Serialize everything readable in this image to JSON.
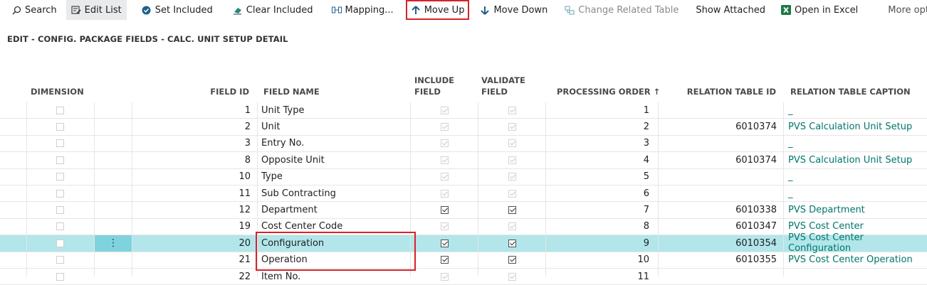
{
  "toolbar": {
    "search": "Search",
    "edit_list": "Edit List",
    "set_included": "Set Included",
    "clear_included": "Clear Included",
    "mapping": "Mapping...",
    "move_up": "Move Up",
    "move_down": "Move Down",
    "change_related_table": "Change Related Table",
    "show_attached": "Show Attached",
    "open_in_excel": "Open in Excel",
    "more_options": "More options"
  },
  "page": {
    "caption": "EDIT - CONFIG. PACKAGE FIELDS - CALC. UNIT SETUP DETAIL"
  },
  "columns": {
    "dimension": "DIMENSION",
    "field_id": "FIELD ID",
    "field_name": "FIELD NAME",
    "include_field_1": "INCLUDE",
    "include_field_2": "FIELD",
    "validate_field_1": "VALIDATE",
    "validate_field_2": "FIELD",
    "processing_order": "PROCESSING ORDER ↑",
    "relation_table_id": "RELATION TABLE ID",
    "relation_table_caption": "RELATION TABLE CAPTION"
  },
  "rows": [
    {
      "field_id": "1",
      "field_name": "Unit Type",
      "include": "ro",
      "validate": "ro",
      "order": "1",
      "rel_id": "",
      "rel_caption": "_"
    },
    {
      "field_id": "2",
      "field_name": "Unit",
      "include": "ro",
      "validate": "ro",
      "order": "2",
      "rel_id": "6010374",
      "rel_caption": "PVS Calculation Unit Setup"
    },
    {
      "field_id": "3",
      "field_name": "Entry No.",
      "include": "ro",
      "validate": "ro",
      "order": "3",
      "rel_id": "",
      "rel_caption": "_"
    },
    {
      "field_id": "8",
      "field_name": "Opposite Unit",
      "include": "ro",
      "validate": "ro",
      "order": "4",
      "rel_id": "6010374",
      "rel_caption": "PVS Calculation Unit Setup"
    },
    {
      "field_id": "10",
      "field_name": "Type",
      "include": "ro",
      "validate": "ro",
      "order": "5",
      "rel_id": "",
      "rel_caption": "_"
    },
    {
      "field_id": "11",
      "field_name": "Sub Contracting",
      "include": "ro",
      "validate": "ro",
      "order": "6",
      "rel_id": "",
      "rel_caption": "_"
    },
    {
      "field_id": "12",
      "field_name": "Department",
      "include": "checked",
      "validate": "checked",
      "order": "7",
      "rel_id": "6010338",
      "rel_caption": "PVS Department"
    },
    {
      "field_id": "19",
      "field_name": "Cost Center Code",
      "include": "ro",
      "validate": "ro",
      "order": "8",
      "rel_id": "6010347",
      "rel_caption": "PVS Cost Center"
    },
    {
      "field_id": "20",
      "field_name": "Configuration",
      "include": "checked",
      "validate": "checked",
      "order": "9",
      "rel_id": "6010354",
      "rel_caption": "PVS Cost Center Configuration"
    },
    {
      "field_id": "21",
      "field_name": "Operation",
      "include": "checked",
      "validate": "checked",
      "order": "10",
      "rel_id": "6010355",
      "rel_caption": "PVS Cost Center Operation"
    },
    {
      "field_id": "22",
      "field_name": "Item No.",
      "include": "ro",
      "validate": "ro",
      "order": "11",
      "rel_id": "",
      "rel_caption": ""
    }
  ],
  "selected_row_index": 8,
  "colors": {
    "selected_row": "#b2e6ea",
    "link": "#00776b",
    "highlight_outline": "#d6232a"
  }
}
